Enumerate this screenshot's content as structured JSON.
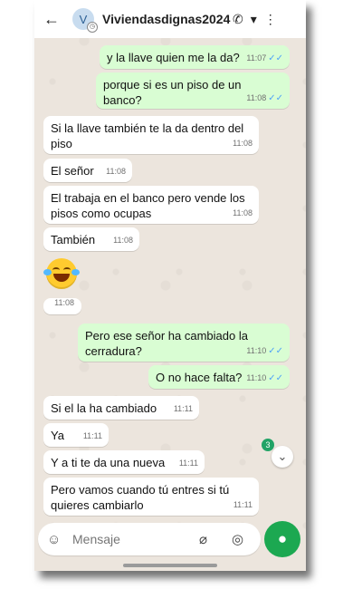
{
  "header": {
    "back_icon": "arrow-left-icon",
    "avatar_letter": "V",
    "contact_name": "Viviendasdignas2024",
    "call_icon": "phone-icon",
    "dropdown_icon": "caret-down-icon",
    "menu_icon": "kebab-menu-icon"
  },
  "messages": [
    {
      "text": "y la llave quien me la da?",
      "time": "11:07",
      "outgoing": true,
      "read": true
    },
    {
      "text": "porque si es un piso de un banco?",
      "time": "11:08",
      "outgoing": true,
      "read": true
    },
    {
      "text": "Si la llave también te la da dentro del piso",
      "time": "11:08",
      "outgoing": false
    },
    {
      "text": "El señor",
      "time": "11:08",
      "outgoing": false
    },
    {
      "text": "El trabaja en el banco pero vende los pisos como ocupas",
      "time": "11:08",
      "outgoing": false
    },
    {
      "text": "También",
      "time": "11:08",
      "outgoing": false
    },
    {
      "text": "😂",
      "time": "11:08",
      "outgoing": false,
      "emoji": true
    },
    {
      "text": "Pero ese señor ha cambiado la cerradura?",
      "time": "11:10",
      "outgoing": true,
      "read": true
    },
    {
      "text": "O no hace falta?",
      "time": "11:10",
      "outgoing": true,
      "read": true
    },
    {
      "text": "Si el la ha cambiado",
      "time": "11:11",
      "outgoing": false
    },
    {
      "text": "Ya",
      "time": "11:11",
      "outgoing": false
    },
    {
      "text": "Y a ti te da una nueva",
      "time": "11:11",
      "outgoing": false
    },
    {
      "text": "Pero vamos cuando tú entres si tú quieres cambiarlo",
      "time": "11:11",
      "outgoing": false
    }
  ],
  "unread_badge": "3",
  "composer": {
    "placeholder": "Mensaje",
    "sticker_icon": "sticker-icon",
    "attach_icon": "paperclip-icon",
    "camera_icon": "camera-icon",
    "mic_icon": "microphone-icon"
  },
  "colors": {
    "outgoing_bubble": "#d9fdd3",
    "incoming_bubble": "#ffffff",
    "accent": "#1ca851",
    "read_ticks": "#4fa3f7"
  }
}
